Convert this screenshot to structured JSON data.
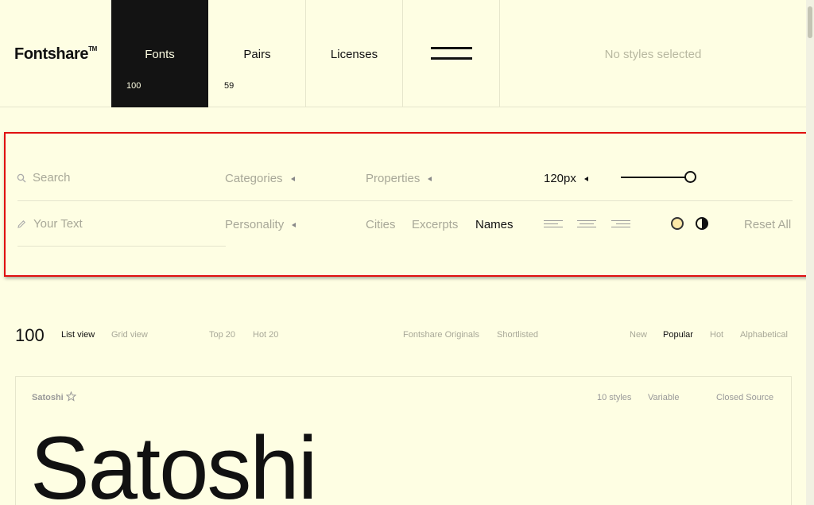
{
  "header": {
    "logo": "Fontshare",
    "logo_tm": "TM",
    "tabs": [
      {
        "label": "Fonts",
        "count": "100"
      },
      {
        "label": "Pairs",
        "count": "59"
      },
      {
        "label": "Licenses"
      }
    ],
    "styles_status": "No styles selected"
  },
  "filters": {
    "search_placeholder": "Search",
    "text_placeholder": "Your Text",
    "categories": "Categories",
    "properties": "Properties",
    "size": "120px",
    "personality": "Personality",
    "preview_modes": [
      "Cities",
      "Excerpts",
      "Names"
    ],
    "reset": "Reset All"
  },
  "listing": {
    "count": "100",
    "views": [
      "List view",
      "Grid view"
    ],
    "lists": [
      "Top 20",
      "Hot 20"
    ],
    "collections": [
      "Fontshare Originals",
      "Shortlisted"
    ],
    "sorts": [
      "New",
      "Popular",
      "Hot",
      "Alphabetical"
    ]
  },
  "card": {
    "name": "Satoshi",
    "styles": "10 styles",
    "variable": "Variable",
    "license": "Closed Source",
    "preview": "Satoshi"
  },
  "colors": {
    "background": "#fefee3",
    "active_tab": "#131313",
    "highlight_border": "#e01010",
    "theme_dot": "#fde9a8"
  }
}
